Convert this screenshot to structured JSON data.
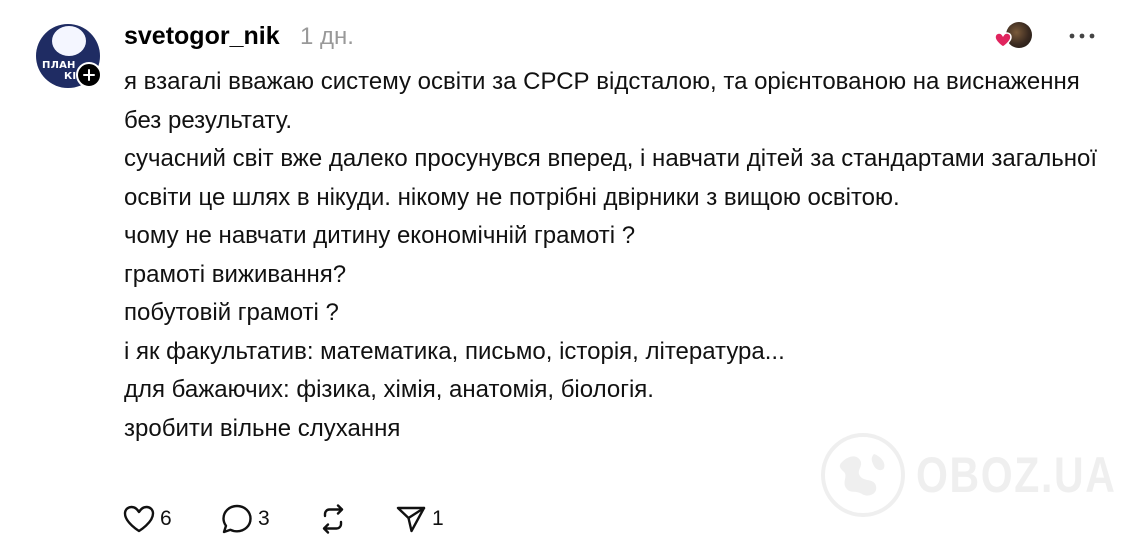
{
  "post": {
    "author": {
      "username": "svetogor_nik",
      "avatar_icon": "avatar-logo",
      "avatar_lettering": [
        "ПЛАН",
        "КІ"
      ]
    },
    "timestamp": "1 дн.",
    "body_lines": [
      "я взагалі вважаю систему освіти за СРСР відсталою, та орієнтованою на виснаження без результату.",
      "сучасний світ вже далеко просунувся вперед, і навчати дітей за стандартами загальної освіти це шлях в нікуди. нікому не потрібні двірники з вищою освітою.",
      "чому не навчати дитину економічній грамоті ?",
      "грамоті виживання?",
      "побутовій грамоті ?",
      "і як факультатив: математика, письмо, історія, література...",
      "для бажаючих: фізика, хімія, анатомія, біологія.",
      "зробити вільне слухання"
    ],
    "actions": {
      "like_count": "6",
      "reply_count": "3",
      "repost_count": "",
      "share_count": "1"
    }
  },
  "watermark": {
    "text": "OBOZ.UA"
  },
  "colors": {
    "timestamp": "#999999",
    "heart": "#e0245e",
    "follow_badge": "#000000",
    "watermark": "#e0e0e0"
  }
}
